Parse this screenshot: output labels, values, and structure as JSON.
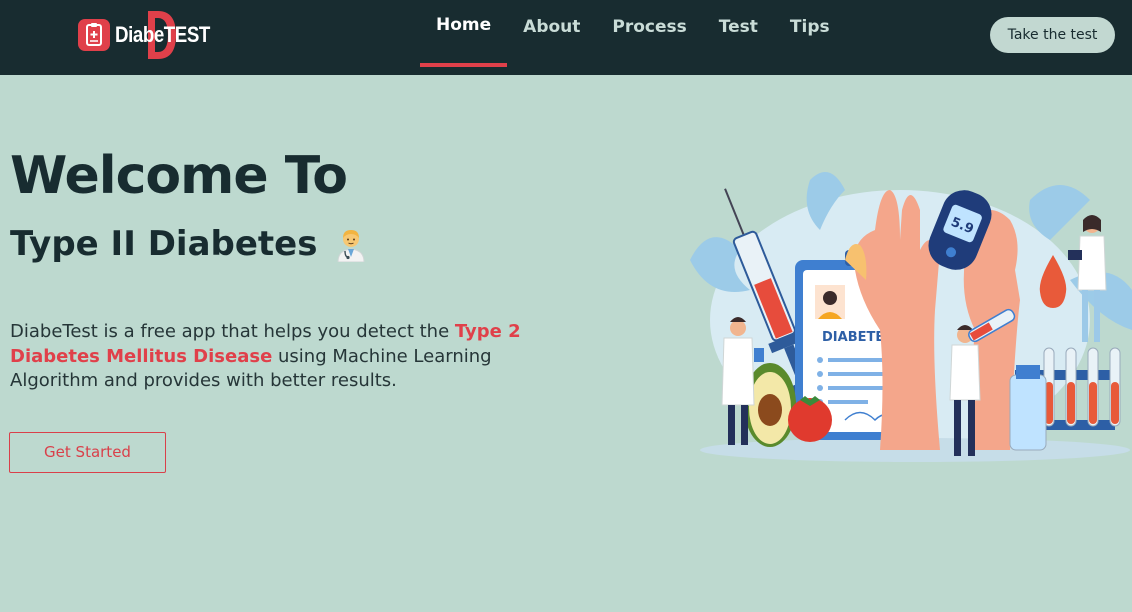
{
  "brand": {
    "name_part1": "Diabe",
    "name_part2": "TEST",
    "logo_icon": "medical-clipboard-icon"
  },
  "nav": {
    "items": [
      {
        "label": "Home",
        "active": true
      },
      {
        "label": "About",
        "active": false
      },
      {
        "label": "Process",
        "active": false
      },
      {
        "label": "Test",
        "active": false
      },
      {
        "label": "Tips",
        "active": false
      }
    ],
    "cta_label": "Take the test"
  },
  "hero": {
    "title": "Welcome To",
    "subtitle": "Type II Diabetes",
    "subtitle_emoji": "doctor-emoji",
    "description_part1": "DiabeTest is a free app that helps you detect the ",
    "description_highlight": "Type 2 Diabetes Mellitus Disease",
    "description_part2": " using Machine Learning Algorithm and provides with better results.",
    "button_label": "Get Started"
  },
  "illustration": {
    "clipboard_heading": "DIABETES",
    "glucometer_reading": "5.9"
  },
  "colors": {
    "navbar_bg": "#182c30",
    "page_bg": "#bdd9cf",
    "accent_red": "#e0404a",
    "text_dark": "#182c30"
  }
}
